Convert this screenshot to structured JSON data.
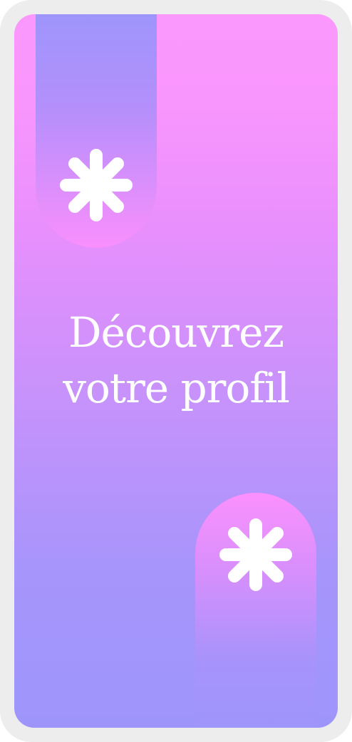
{
  "screen": {
    "headline_line1": "Découvrez",
    "headline_line2": "votre profil"
  },
  "icons": {
    "top": "asterisk-icon",
    "bottom": "asterisk-icon"
  },
  "colors": {
    "frame": "#ededed",
    "gradient_top": "#fb98fd",
    "gradient_bottom": "#9e95fb",
    "text": "#ffffff",
    "icon": "#ffffff"
  }
}
